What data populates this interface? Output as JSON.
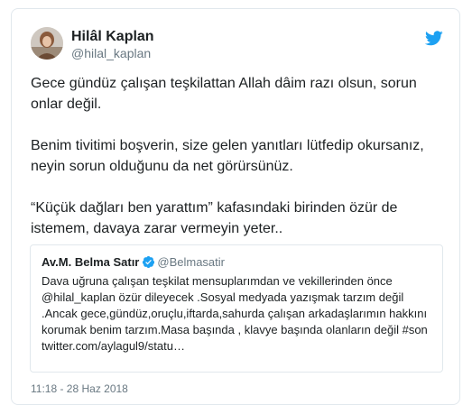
{
  "tweet": {
    "author_name": "Hilâl Kaplan",
    "author_handle": "@hilal_kaplan",
    "paragraphs": [
      "Gece gündüz çalışan teşkilattan Allah dâim razı olsun, sorun onlar değil.",
      "Benim tivitimi boşverin, size gelen yanıtları lütfedip okursanız, neyin sorun olduğunu da net görürsünüz.",
      "“Küçük dağları ben yarattım” kafasındaki birinden özür de istemem, davaya zarar vermeyin yeter.."
    ],
    "timestamp": "11:18 - 28 Haz 2018"
  },
  "quoted_tweet": {
    "author_name": "Av.M. Belma Satır",
    "author_handle": "@Belmasatir",
    "text": "Dava uğruna çalışan teşkilat mensuplarımdan ve vekillerinden önce @hilal_kaplan özür dileyecek .Sosyal medyada yazışmak tarzım değil .Ancak gece,gündüz,oruçlu,iftarda,sahurda çalışan arkadaşlarımın hakkını korumak benim tarzım.Masa başında , klavye başında olanların değil #son twitter.com/aylagul9/statu…"
  },
  "icons": {
    "brand": "twitter-bird-icon",
    "verified": "verified-badge-icon"
  },
  "colors": {
    "twitter_blue": "#1da1f2",
    "text": "#1c2022",
    "muted": "#697882",
    "border": "#e1e8ed"
  }
}
